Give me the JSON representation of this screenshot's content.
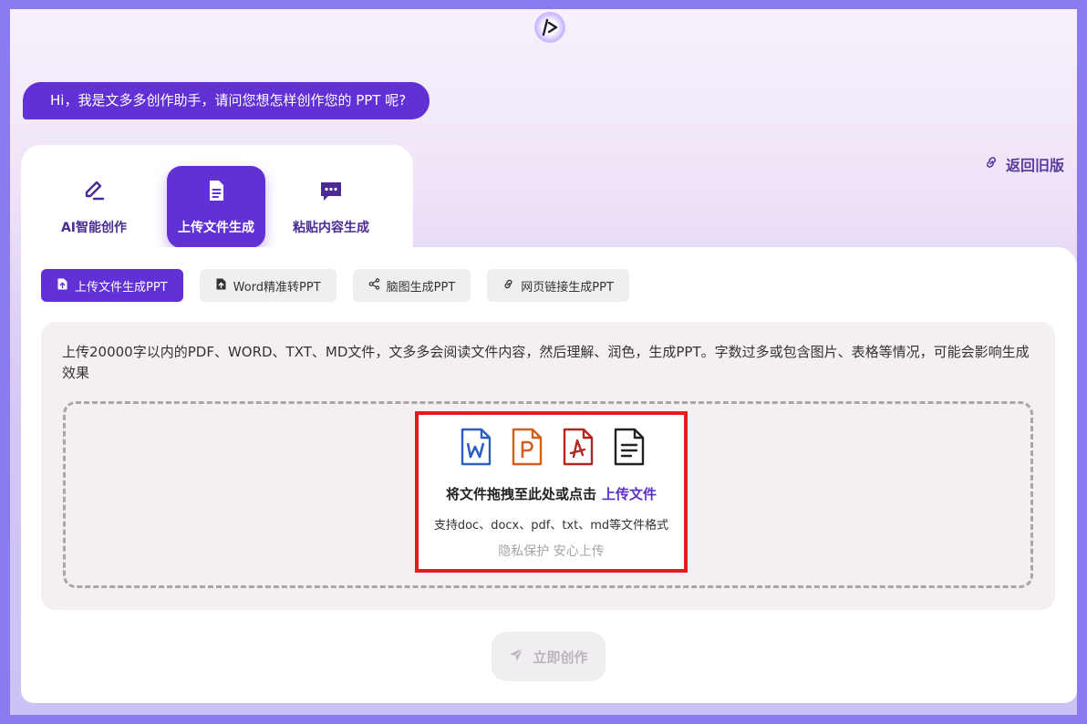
{
  "greeting": "Hi，我是文多多创作助手，请问您想怎样创作您的 PPT 呢?",
  "back_link": "返回旧版",
  "tabs": [
    {
      "label": "AI智能创作",
      "icon": "pen-icon",
      "active": false
    },
    {
      "label": "上传文件生成",
      "icon": "document-icon",
      "active": true
    },
    {
      "label": "粘贴内容生成",
      "icon": "chat-icon",
      "active": false
    }
  ],
  "subtabs": [
    {
      "label": "上传文件生成PPT",
      "icon": "file-upload-icon",
      "active": true
    },
    {
      "label": "Word精准转PPT",
      "icon": "file-upload-icon",
      "active": false
    },
    {
      "label": "脑图生成PPT",
      "icon": "mindmap-icon",
      "active": false
    },
    {
      "label": "网页链接生成PPT",
      "icon": "link-icon",
      "active": false
    }
  ],
  "upload": {
    "description": "上传20000字以内的PDF、WORD、TXT、MD文件，文多多会阅读文件内容，然后理解、润色，生成PPT。字数过多或包含图片、表格等情况，可能会影响生成效果",
    "drop_text": "将文件拖拽至此处或点击",
    "upload_link": "上传文件",
    "formats": "支持doc、docx、pdf、txt、md等文件格式",
    "privacy": "隐私保护 安心上传",
    "file_icons": [
      "word-file-icon",
      "ppt-file-icon",
      "pdf-file-icon",
      "text-file-icon"
    ]
  },
  "create_button": "立即创作",
  "colors": {
    "accent": "#6131d6",
    "highlight": "#e01e1e",
    "word": "#2b5fc4",
    "ppt": "#d2601a",
    "pdf": "#b3261e"
  }
}
